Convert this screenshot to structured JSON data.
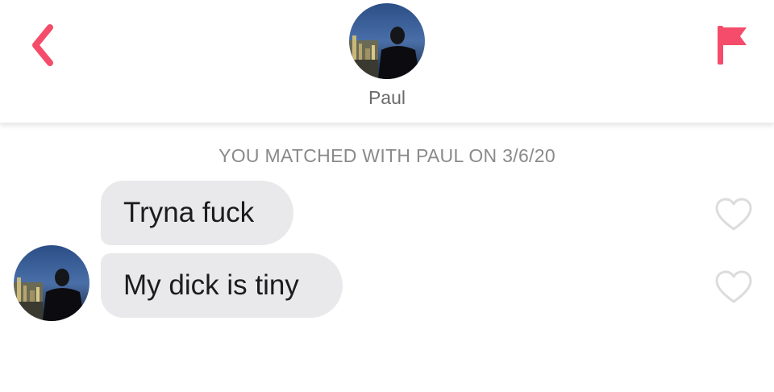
{
  "header": {
    "back_icon": "chevron-left-icon",
    "report_icon": "flag-icon",
    "match_name": "Paul",
    "accent_color": "#f44c6a"
  },
  "chat": {
    "match_notice": "YOU MATCHED WITH PAUL ON 3/6/20",
    "messages": [
      {
        "text": "Tryna fuck",
        "liked": false
      },
      {
        "text": "My dick is tiny",
        "liked": false
      }
    ],
    "bubble_color": "#e9e9eb",
    "like_icon": "heart-outline-icon"
  }
}
